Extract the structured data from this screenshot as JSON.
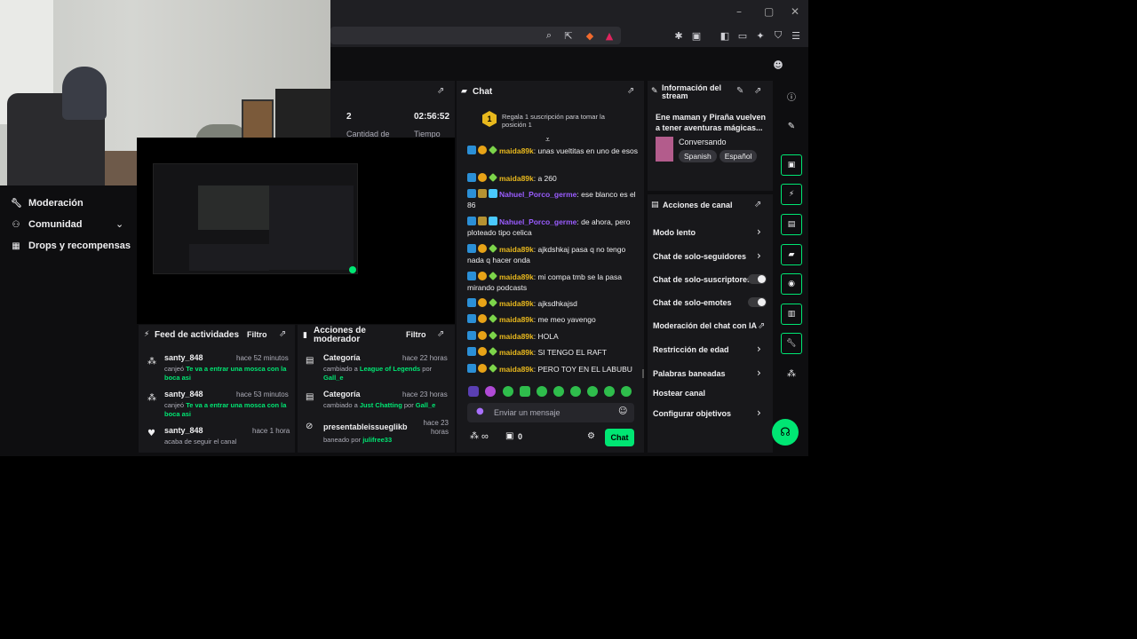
{
  "window": {
    "minimize": "–",
    "maximize": "▢",
    "close": "✕"
  },
  "nav": {
    "items": [
      {
        "label": "Moderación",
        "icon": "wrench-icon"
      },
      {
        "label": "Comunidad",
        "icon": "people-icon"
      },
      {
        "label": "Drops y recompensas",
        "icon": "gift-icon"
      }
    ]
  },
  "stats": {
    "values": [
      "2",
      "02:56:52"
    ],
    "labels": [
      "Cantidad de",
      "Tiempo"
    ]
  },
  "chat": {
    "title": "Chat",
    "pinned": "Regala 1 suscripción para tomar la posición 1",
    "pinned_rank": "1",
    "messages": [
      {
        "user": "maida89k",
        "text": ": unas vueltitas en uno de esos",
        "color": "yellow"
      },
      {
        "user": "maida89k",
        "text": ": a 260",
        "color": "yellow"
      },
      {
        "user": "Nahuel_Porco_germe",
        "text": ": ese blanco es el 86",
        "color": "purple"
      },
      {
        "user": "Nahuel_Porco_germe",
        "text": ": de ahora, pero ploteado tipo celica",
        "color": "purple"
      },
      {
        "user": "maida89k",
        "text": ": ajkdshkaj pasa q no tengo nada q hacer onda",
        "color": "yellow"
      },
      {
        "user": "maida89k",
        "text": ": mi compa tmb se la pasa mirando podcasts",
        "color": "yellow"
      },
      {
        "user": "maida89k",
        "text": ": ajksdhkajsd",
        "color": "yellow"
      },
      {
        "user": "maida89k",
        "text": ": me meo yavengo",
        "color": "yellow"
      },
      {
        "user": "maida89k",
        "text": ": HOLA",
        "color": "yellow"
      },
      {
        "user": "maida89k",
        "text": ": SI TENGO EL RAFT",
        "color": "yellow"
      },
      {
        "user": "maida89k",
        "text": ": PERO TOY EN EL LABUBU",
        "color": "yellow"
      }
    ],
    "placeholder": "Enviar un mensaje",
    "viewers": "∞",
    "points": "0",
    "send_label": "Chat"
  },
  "stream_info": {
    "title": "Información del stream",
    "stream_title": "Ene maman y Piraña vuelven a tener aventuras mágicas...",
    "category": "Conversando",
    "tags": [
      "Spanish",
      "Español"
    ]
  },
  "channel_actions": {
    "title": "Acciones de canal",
    "items": [
      {
        "label": "Modo lento",
        "control": "chevron"
      },
      {
        "label": "Chat de solo-seguidores",
        "control": "chevron"
      },
      {
        "label": "Chat de solo-suscriptores",
        "control": "toggle"
      },
      {
        "label": "Chat de solo-emotes",
        "control": "toggle"
      },
      {
        "label": "Moderación del chat con IA",
        "control": "popout"
      },
      {
        "label": "Restricción de edad",
        "control": "chevron"
      },
      {
        "label": "Palabras baneadas",
        "control": "chevron"
      },
      {
        "label": "Hostear canal",
        "control": "none"
      },
      {
        "label": "Configurar objetivos",
        "control": "chevron"
      }
    ]
  },
  "activity_feed": {
    "title": "Feed de actividades",
    "filter": "Filtro",
    "items": [
      {
        "user": "santy_848",
        "time": "hace 52 minutos",
        "prefix": "canjeó ",
        "highlight": "Te va a entrar una mosca con la boca asi"
      },
      {
        "user": "santy_848",
        "time": "hace 53 minutos",
        "prefix": "canjeó ",
        "highlight": "Te va a entrar una mosca con la boca asi"
      },
      {
        "user": "santy_848",
        "time": "hace 1 hora",
        "prefix": "acaba de seguir el canal",
        "highlight": ""
      }
    ]
  },
  "mod_actions": {
    "title": "Acciones de moderador",
    "filter": "Filtro",
    "items": [
      {
        "title": "Categoría",
        "time": "hace 22 horas",
        "pre": "cambiado a ",
        "hl1": "League of Legends",
        "mid": " por ",
        "hl2": "Gall_e"
      },
      {
        "title": "Categoría",
        "time": "hace 23 horas",
        "pre": "cambiado a ",
        "hl1": "Just Chatting",
        "mid": " por ",
        "hl2": "Gall_e"
      },
      {
        "title": "presentableissueglikb",
        "time": "hace 23 horas",
        "pre": "baneado por ",
        "hl1": "julifree33",
        "mid": "",
        "hl2": ""
      }
    ]
  },
  "colors": {
    "accent": "#00e673",
    "panel": "#18181b",
    "bg": "#0e0e10"
  }
}
